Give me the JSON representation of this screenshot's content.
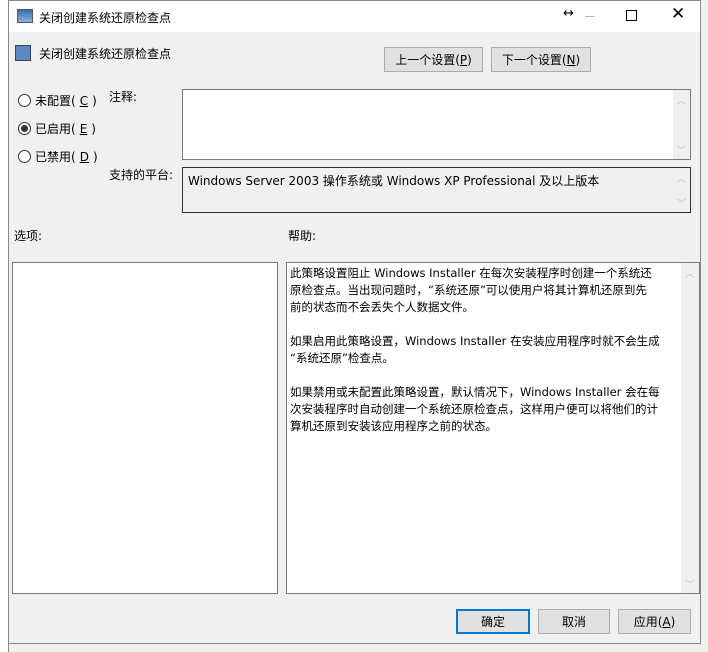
{
  "window": {
    "title": "关闭创建系统还原检查点",
    "resize_glyph": "↔"
  },
  "header": {
    "title": "关闭创建系统还原检查点",
    "prev_button": "上一个设置(",
    "prev_key": "P",
    "next_button": "下一个设置(",
    "next_key": "N"
  },
  "radios": [
    {
      "label": "未配置(",
      "key": "C",
      "checked": false
    },
    {
      "label": "已启用(",
      "key": "E",
      "checked": true
    },
    {
      "label": "已禁用(",
      "key": "D",
      "checked": false
    }
  ],
  "comment_label": "注释:",
  "comment_value": "",
  "platform_label": "支持的平台:",
  "platform_value": "Windows Server 2003 操作系统或 Windows XP Professional 及以上版本",
  "options_label": "选项:",
  "help_label": "帮助:",
  "help_lines": [
    "此策略设置阻止 Windows Installer 在每次安装程序时创建一个系统还",
    "原检查点。当出现问题时，“系统还原”可以使用户将其计算机还原到先",
    "前的状态而不会丢失个人数据文件。",
    "",
    "如果启用此策略设置，Windows Installer 在安装应用程序时就不会生成",
    "“系统还原”检查点。",
    "",
    "如果禁用或未配置此策略设置，默认情况下，Windows Installer 会在每",
    "次安装程序时自动创建一个系统还原检查点，这样用户便可以将他们的计",
    "算机还原到安装该应用程序之前的状态。"
  ],
  "footer": {
    "ok": "确定",
    "cancel": "取消",
    "apply": "应用(",
    "apply_key": "A"
  }
}
